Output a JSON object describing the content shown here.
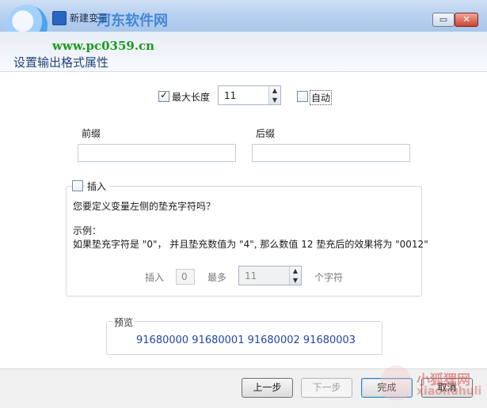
{
  "window": {
    "title": "新建变量",
    "brand_overlay": "河东软件网",
    "watermark_url": "www.pc0359.cn",
    "min_glyph": "▭",
    "close_glyph": "✕"
  },
  "page": {
    "section_title": "设置输出格式属性"
  },
  "max_length": {
    "checkbox_label": "最大长度",
    "checked": true,
    "value": "11",
    "auto_label": "自动",
    "auto_checked": false
  },
  "prefix": {
    "label": "前缀",
    "value": ""
  },
  "suffix": {
    "label": "后缀",
    "value": ""
  },
  "padding": {
    "checkbox_label": "插入",
    "checked": false,
    "question": "您要定义变量左侧的垫充字符吗？",
    "example_title": "示例：",
    "example_text": "如果垫充字符是 \"0\"， 并且垫充数值为 \"4\", 那么数值 12 垫充后的效果将为 \"0012\"",
    "insert_label": "插入",
    "insert_value": "0",
    "max_label": "最多",
    "max_value": "11",
    "unit_label": "个字符"
  },
  "preview": {
    "label": "预览",
    "text": "91680000 91680001 91680002 91680003"
  },
  "buttons": {
    "back": "上一步",
    "next": "下一步",
    "finish": "完成",
    "cancel": "取消"
  },
  "watermark": {
    "corner_text": "小狐狸网",
    "corner_sub": "xiaohuhuli"
  },
  "spin_arrows": {
    "up": "▲",
    "down": "▼"
  }
}
